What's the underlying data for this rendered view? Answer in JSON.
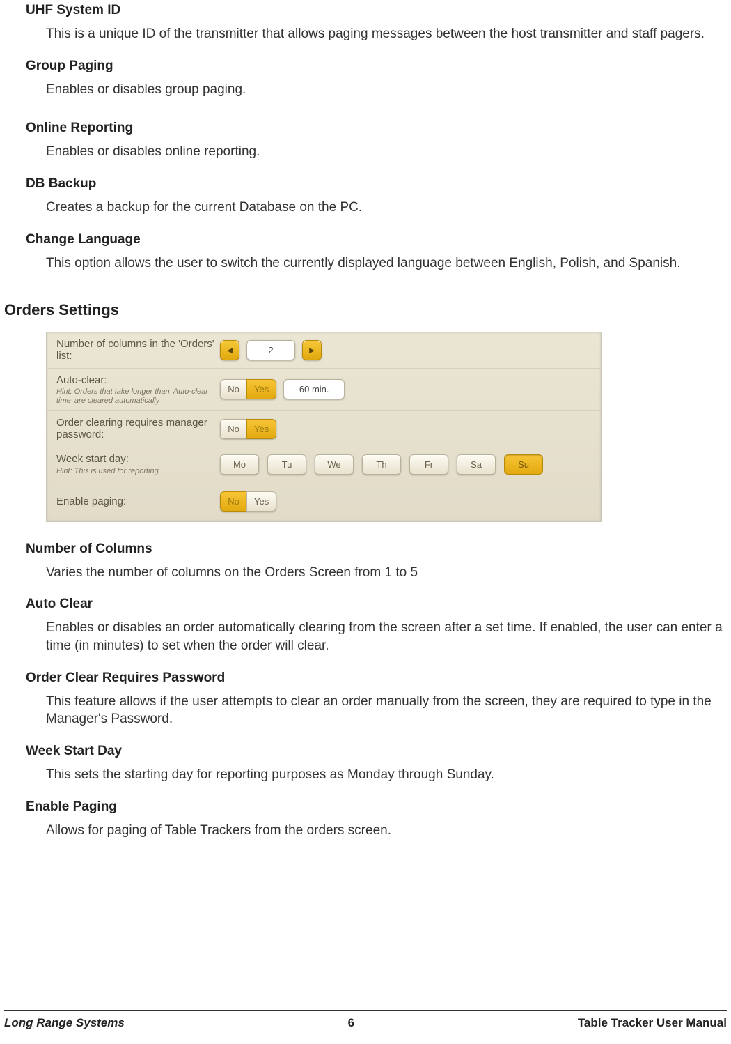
{
  "sections": {
    "uhf_system_id": {
      "heading": "UHF System ID",
      "body": "This is a unique ID of the transmitter that allows paging messages between the host transmitter and staff pagers."
    },
    "group_paging": {
      "heading": "Group Paging",
      "body": "Enables or disables group paging."
    },
    "online_reporting": {
      "heading": "Online Reporting",
      "body": "Enables or disables online reporting."
    },
    "db_backup": {
      "heading": "DB Backup",
      "body": "Creates a backup for the current Database on the PC."
    },
    "change_language": {
      "heading": "Change Language",
      "body": "This option allows the user to switch the currently displayed language between English, Polish, and Spanish."
    }
  },
  "orders_settings": {
    "heading": "Orders Settings",
    "panel": {
      "columns": {
        "label": "Number of columns in the 'Orders' list:",
        "left_arrow": "◄",
        "value": "2",
        "right_arrow": "►"
      },
      "auto_clear": {
        "label": "Auto-clear:",
        "hint": "Hint: Orders that take longer than 'Auto-clear time' are cleared automatically",
        "no": "No",
        "yes": "Yes",
        "minutes": "60 min."
      },
      "requires_password": {
        "label": "Order clearing requires manager password:",
        "no": "No",
        "yes": "Yes"
      },
      "week_start": {
        "label": "Week start day:",
        "hint": "Hint: This is used for reporting",
        "days": [
          "Mo",
          "Tu",
          "We",
          "Th",
          "Fr",
          "Sa",
          "Su"
        ]
      },
      "enable_paging": {
        "label": "Enable paging:",
        "no": "No",
        "yes": "Yes"
      }
    },
    "items": {
      "number_of_columns": {
        "heading": "Number of Columns",
        "body": "Varies the number of columns on the Orders Screen from 1 to 5"
      },
      "auto_clear": {
        "heading": "Auto Clear",
        "body": "Enables or disables an order automatically clearing from the screen after a set time. If enabled, the user can enter a time (in minutes) to set when the order will clear."
      },
      "order_clear_password": {
        "heading": "Order Clear Requires Password",
        "body": "This feature allows if the user attempts to clear an order manually from the screen, they are required to type in the Manager's Password."
      },
      "week_start_day": {
        "heading": "Week Start Day",
        "body": "This sets the starting day for reporting purposes as Monday through Sunday."
      },
      "enable_paging": {
        "heading": "Enable Paging",
        "body": "Allows for paging of Table Trackers from the orders screen."
      }
    }
  },
  "footer": {
    "left": "Long Range Systems",
    "center": "6",
    "right": "Table Tracker User Manual"
  }
}
